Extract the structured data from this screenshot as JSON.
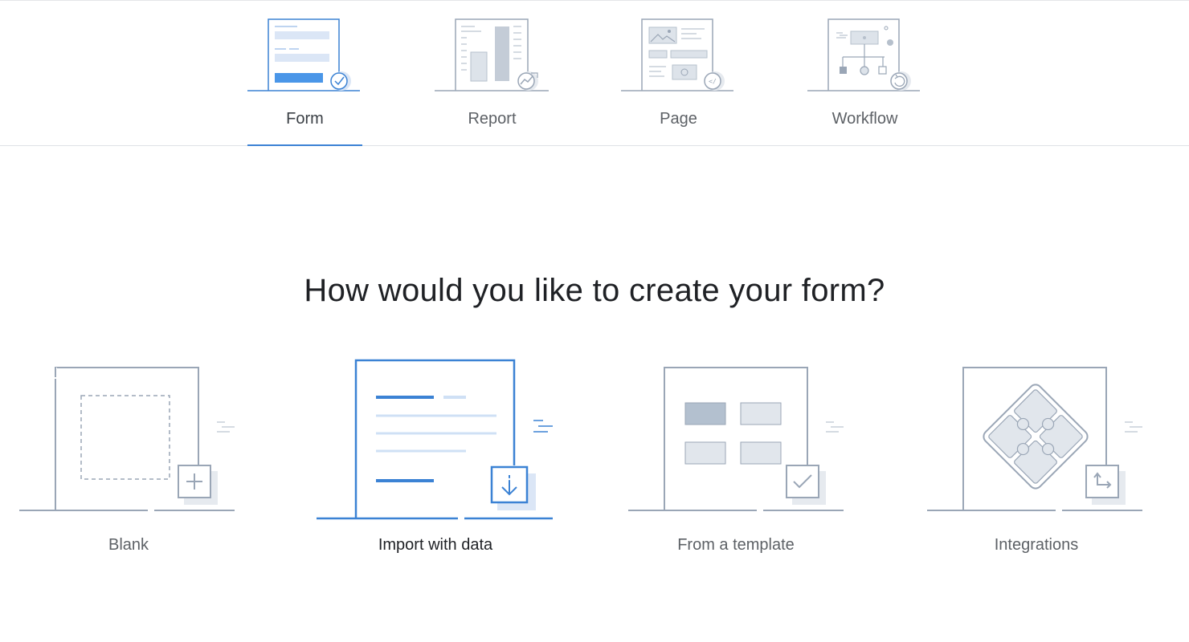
{
  "tabs": [
    {
      "label": "Form",
      "icon": "form-icon",
      "active": true
    },
    {
      "label": "Report",
      "icon": "report-icon",
      "active": false
    },
    {
      "label": "Page",
      "icon": "page-icon",
      "active": false
    },
    {
      "label": "Workflow",
      "icon": "workflow-icon",
      "active": false
    }
  ],
  "headline": "How would you like to create your form?",
  "options": [
    {
      "label": "Blank",
      "icon": "blank-form-icon",
      "selected": false
    },
    {
      "label": "Import with data",
      "icon": "import-data-icon",
      "selected": true
    },
    {
      "label": "From a template",
      "icon": "template-icon",
      "selected": false
    },
    {
      "label": "Integrations",
      "icon": "integrations-puzzle-icon",
      "selected": false
    }
  ],
  "colors": {
    "accent": "#3b82d4",
    "illustration_gray": "#9aa6b6",
    "text_dark": "#1f2125",
    "text_muted": "#5d6166"
  }
}
